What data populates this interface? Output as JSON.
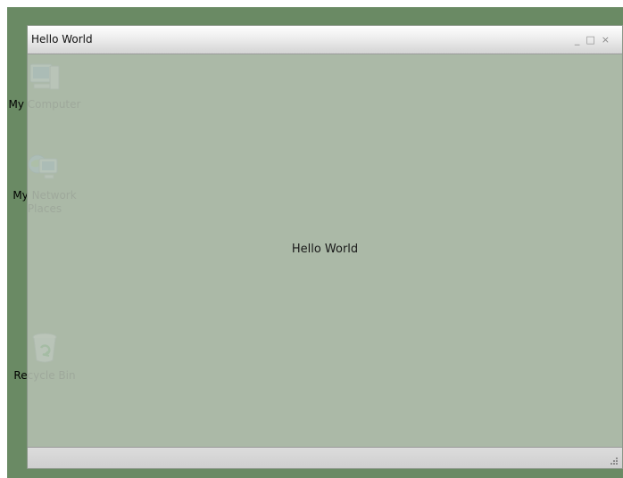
{
  "desktop": {
    "icons": [
      {
        "label": "My Computer",
        "icon": "computer-icon"
      },
      {
        "label": "My Network Places",
        "icon": "network-icon"
      },
      {
        "label": "Recycle Bin",
        "icon": "recycle-bin-icon"
      }
    ]
  },
  "window": {
    "title": "Hello World",
    "controls": {
      "minimize": "_",
      "maximize": "□",
      "close": "×"
    },
    "content_text": "Hello World"
  },
  "colors": {
    "desktop_bg": "#6a8a64",
    "window_tint": "#b4bfb1"
  }
}
